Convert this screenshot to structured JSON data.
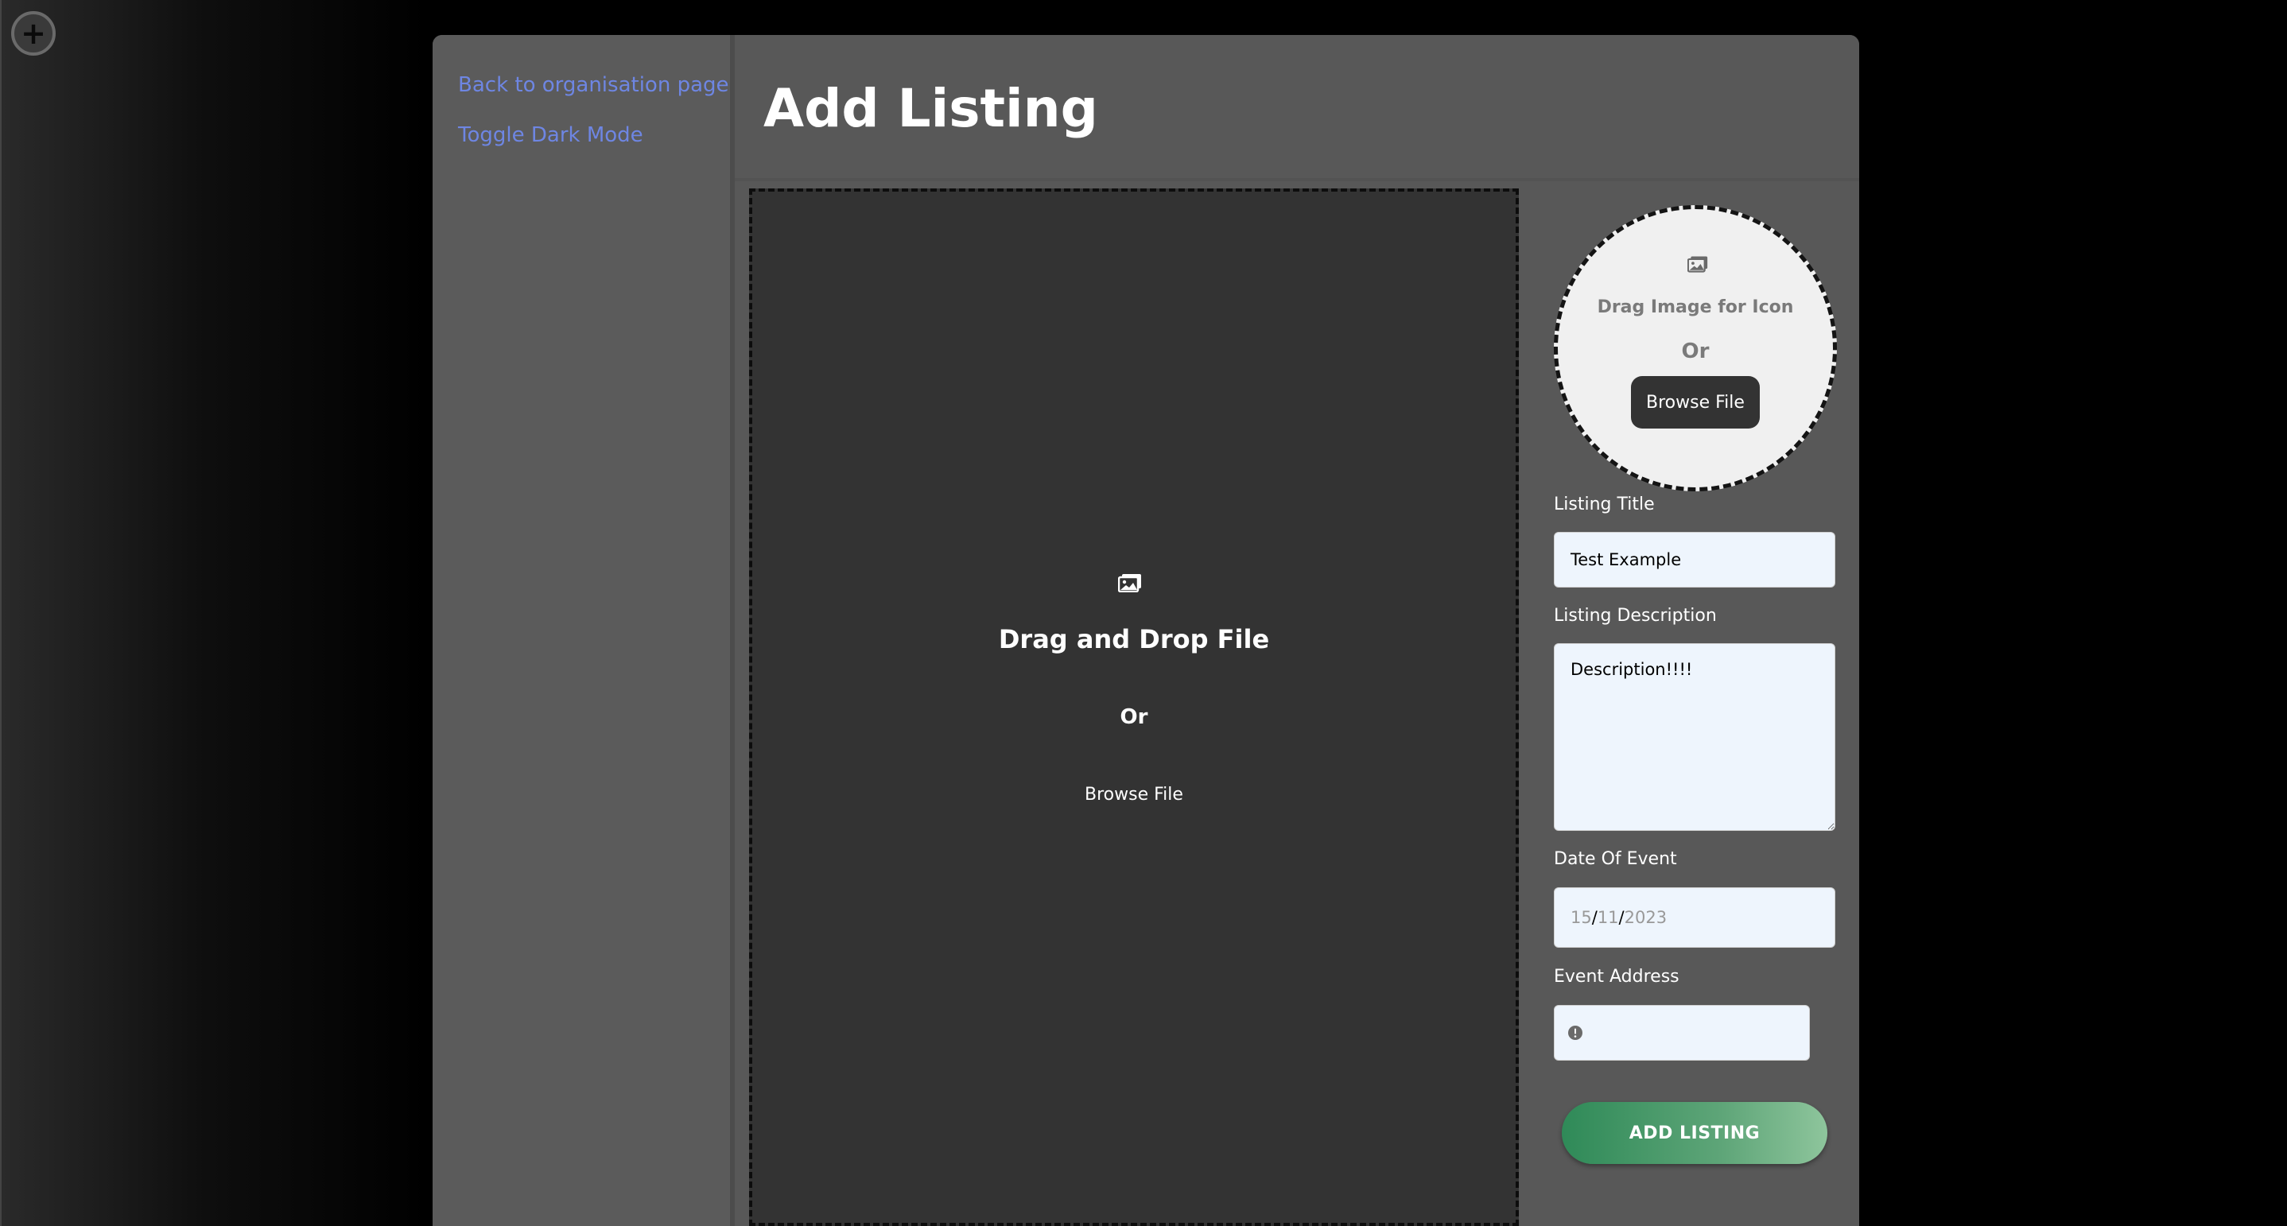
{
  "window": {
    "corner_button_icon": "plus-icon"
  },
  "sidebar": {
    "back_link": "Back to organisation page",
    "dark_mode_link": "Toggle Dark Mode"
  },
  "header": {
    "title": "Add Listing"
  },
  "main_dropzone": {
    "icon": "image-icon",
    "title": "Drag and Drop File",
    "or_text": "Or",
    "browse_label": "Browse File"
  },
  "icon_dropzone": {
    "icon": "image-icon",
    "text": "Drag Image for Icon",
    "or_text": "Or",
    "browse_label": "Browse File"
  },
  "form": {
    "title_label": "Listing Title",
    "title_value": "Test Example",
    "description_label": "Listing Description",
    "description_value": "Description!!!!",
    "date_label": "Date Of Event",
    "date_day": "15",
    "date_month": "11",
    "date_year": "2023",
    "date_separator": "/",
    "address_label": "Event Address",
    "address_value": "",
    "address_icon": "alert-icon",
    "submit_label": "ADD LISTING"
  },
  "colors": {
    "link": "#6e86e3",
    "panel": "#585858",
    "dropzone": "#333333",
    "input_bg": "#eef5fd",
    "button_start": "#2f8a58",
    "button_end": "#8ec59c"
  }
}
